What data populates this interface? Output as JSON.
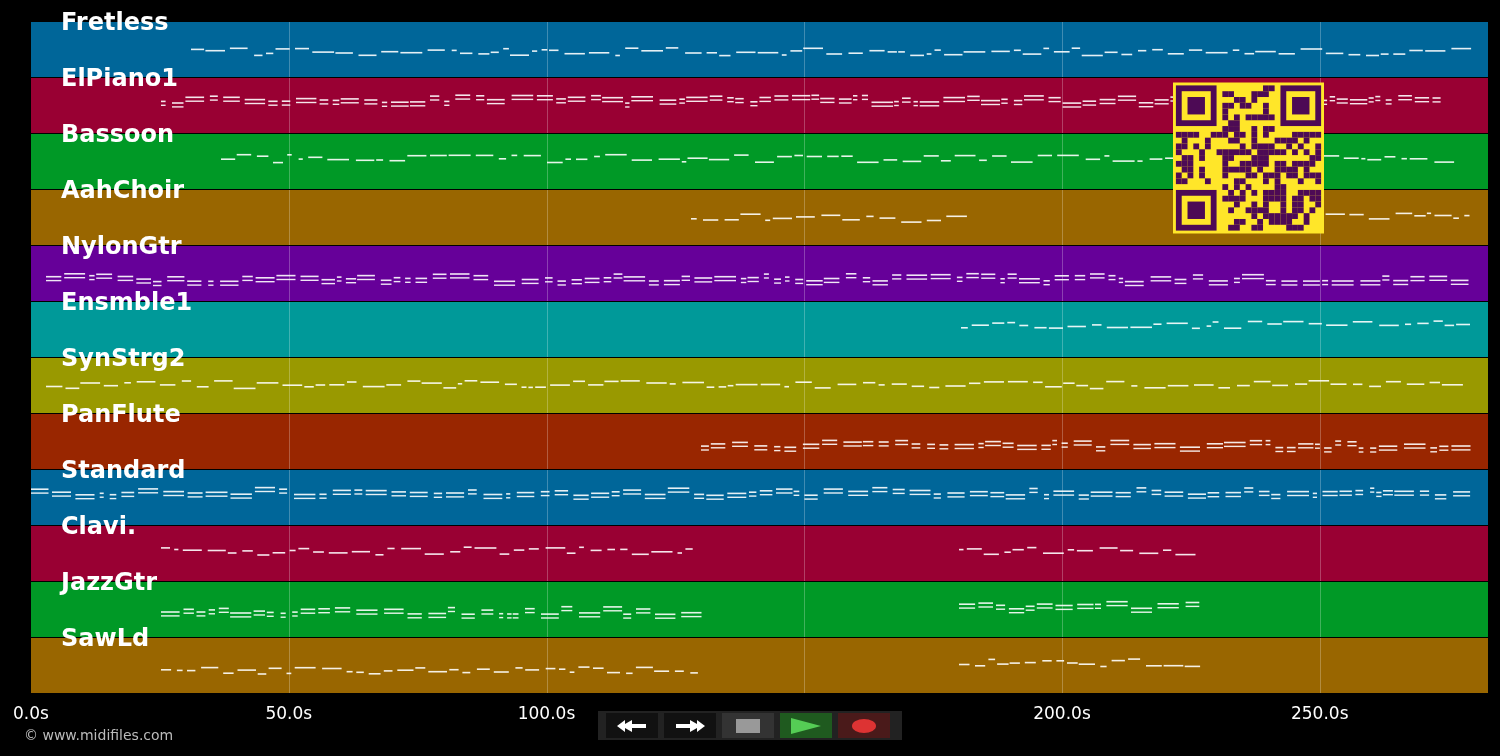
{
  "tracks": [
    {
      "name": "Fretless",
      "color": "#006699"
    },
    {
      "name": "ElPiano1",
      "color": "#990033"
    },
    {
      "name": "Bassoon",
      "color": "#009926"
    },
    {
      "name": "AahChoir",
      "color": "#996600"
    },
    {
      "name": "NylonGtr",
      "color": "#660099"
    },
    {
      "name": "Ensmble1",
      "color": "#009999"
    },
    {
      "name": "SynStrg2",
      "color": "#999900"
    },
    {
      "name": "PanFlute",
      "color": "#992600"
    },
    {
      "name": "Standard",
      "color": "#006699"
    },
    {
      "name": "Clavi.",
      "color": "#990033"
    },
    {
      "name": "JazzGtr",
      "color": "#009926"
    },
    {
      "name": "SawLd",
      "color": "#996600"
    }
  ],
  "x_axis": {
    "tick_labels": [
      "0.0s",
      "50.0s",
      "100.0s",
      "200.0s",
      "250.0s"
    ]
  },
  "controls": [
    {
      "kind": "rewind"
    },
    {
      "kind": "forward"
    },
    {
      "kind": "stop"
    },
    {
      "kind": "play"
    },
    {
      "kind": "record"
    }
  ],
  "copyright": "© www.midifiles.com"
}
